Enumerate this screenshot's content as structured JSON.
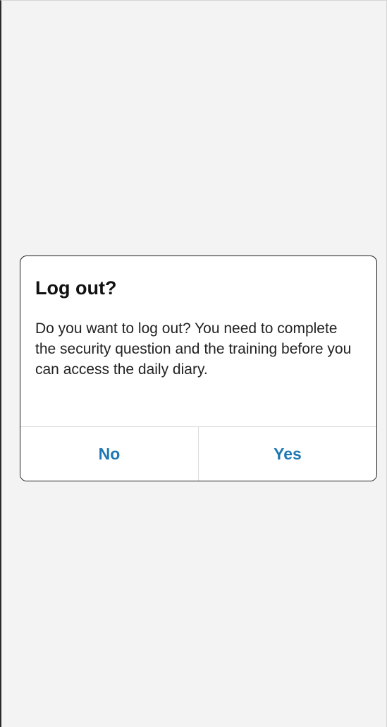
{
  "dialog": {
    "title": "Log out?",
    "message": "Do you want to log out? You need to complete the security question and the training before you can access the daily diary.",
    "buttons": {
      "no": "No",
      "yes": "Yes"
    }
  },
  "colors": {
    "background": "#f3f3f3",
    "dialog_background": "#ffffff",
    "button_text": "#1f78b4",
    "title_text": "#111111",
    "divider": "#dddddd"
  }
}
